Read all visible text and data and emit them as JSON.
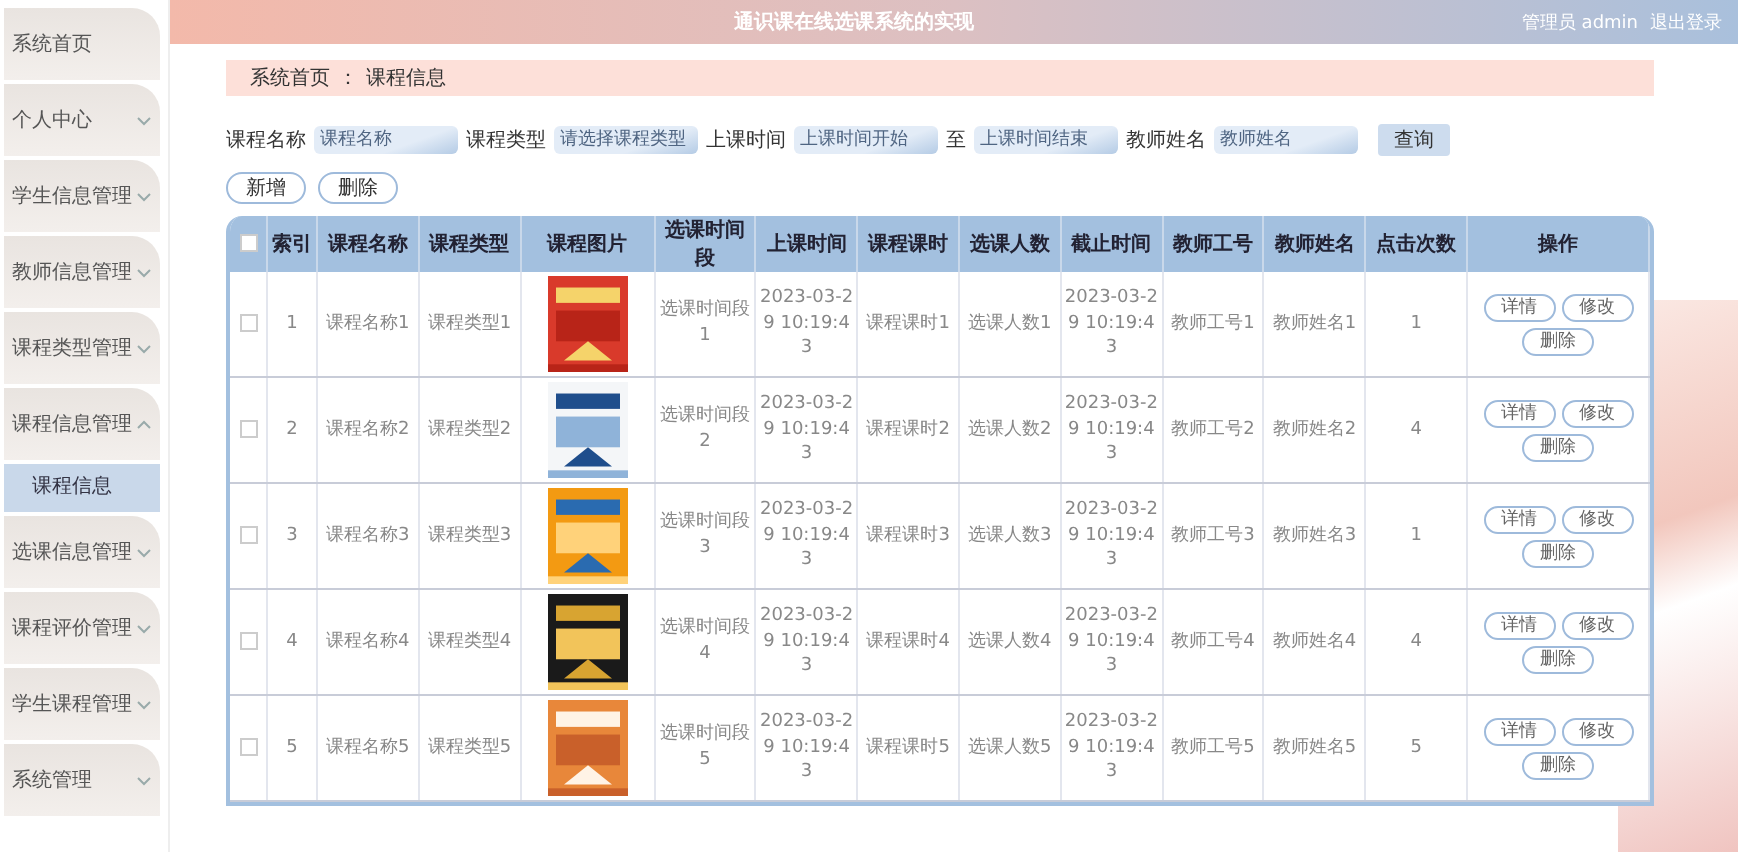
{
  "header": {
    "title": "通识课在线选课系统的实现",
    "user": "管理员 admin",
    "logout": "退出登录"
  },
  "sidebar": {
    "items": [
      {
        "label": "系统首页",
        "kind": "link"
      },
      {
        "label": "个人中心",
        "kind": "menu",
        "expanded": false
      },
      {
        "label": "学生信息管理",
        "kind": "menu",
        "expanded": false
      },
      {
        "label": "教师信息管理",
        "kind": "menu",
        "expanded": false
      },
      {
        "label": "课程类型管理",
        "kind": "menu",
        "expanded": false
      },
      {
        "label": "课程信息管理",
        "kind": "menu",
        "expanded": true,
        "children": [
          {
            "label": "课程信息",
            "selected": true
          }
        ]
      },
      {
        "label": "选课信息管理",
        "kind": "menu",
        "expanded": false
      },
      {
        "label": "课程评价管理",
        "kind": "menu",
        "expanded": false
      },
      {
        "label": "学生课程管理",
        "kind": "menu",
        "expanded": false
      },
      {
        "label": "系统管理",
        "kind": "menu",
        "expanded": false
      }
    ]
  },
  "breadcrumb": {
    "home": "系统首页",
    "separator": "：",
    "current": "课程信息"
  },
  "search": {
    "fields": [
      {
        "label": "课程名称",
        "placeholder": "课程名称"
      },
      {
        "label": "课程类型",
        "placeholder": "请选择课程类型"
      },
      {
        "label": "上课时间",
        "placeholder": "上课时间开始"
      },
      {
        "label": "至",
        "placeholder": "上课时间结束"
      },
      {
        "label": "教师姓名",
        "placeholder": "教师姓名"
      }
    ],
    "button": "查询"
  },
  "actions": [
    "新增",
    "删除"
  ],
  "table": {
    "columns": [
      {
        "kind": "checkbox",
        "checked": false
      },
      {
        "kind": "text",
        "label": "索引"
      },
      {
        "kind": "text",
        "label": "课程名称"
      },
      {
        "kind": "text",
        "label": "课程类型"
      },
      {
        "kind": "text",
        "label": "课程图片"
      },
      {
        "kind": "text",
        "label": "选课时间段"
      },
      {
        "kind": "text",
        "label": "上课时间"
      },
      {
        "kind": "text",
        "label": "课程课时"
      },
      {
        "kind": "text",
        "label": "选课人数"
      },
      {
        "kind": "text",
        "label": "截止时间"
      },
      {
        "kind": "text",
        "label": "教师工号"
      },
      {
        "kind": "text",
        "label": "教师姓名"
      },
      {
        "kind": "text",
        "label": "点击次数"
      },
      {
        "kind": "text",
        "label": "操作"
      }
    ],
    "rows": [
      {
        "cells": [
          {
            "kind": "checkbox",
            "checked": false
          },
          {
            "kind": "text",
            "text": "1"
          },
          {
            "kind": "text",
            "text": "课程名称1"
          },
          {
            "kind": "text",
            "text": "课程类型1"
          },
          {
            "kind": "picture"
          },
          {
            "kind": "text",
            "text": "选课时间段1"
          },
          {
            "kind": "text",
            "text": "2023-03-29 10:19:43"
          },
          {
            "kind": "text",
            "text": "课程课时1"
          },
          {
            "kind": "text",
            "text": "选课人数1"
          },
          {
            "kind": "text",
            "text": "2023-03-29 10:19:43"
          },
          {
            "kind": "text",
            "text": "教师工号1"
          },
          {
            "kind": "text",
            "text": "教师姓名1"
          },
          {
            "kind": "text",
            "text": "1"
          },
          {
            "kind": "buttons",
            "buttons": [
              "详情",
              "修改",
              "删除"
            ]
          }
        ]
      },
      {
        "cells": [
          {
            "kind": "checkbox",
            "checked": false
          },
          {
            "kind": "text",
            "text": "2"
          },
          {
            "kind": "text",
            "text": "课程名称2"
          },
          {
            "kind": "text",
            "text": "课程类型2"
          },
          {
            "kind": "picture"
          },
          {
            "kind": "text",
            "text": "选课时间段2"
          },
          {
            "kind": "text",
            "text": "2023-03-29 10:19:43"
          },
          {
            "kind": "text",
            "text": "课程课时2"
          },
          {
            "kind": "text",
            "text": "选课人数2"
          },
          {
            "kind": "text",
            "text": "2023-03-29 10:19:43"
          },
          {
            "kind": "text",
            "text": "教师工号2"
          },
          {
            "kind": "text",
            "text": "教师姓名2"
          },
          {
            "kind": "text",
            "text": "4"
          },
          {
            "kind": "buttons",
            "buttons": [
              "详情",
              "修改",
              "删除"
            ]
          }
        ]
      },
      {
        "cells": [
          {
            "kind": "checkbox",
            "checked": false
          },
          {
            "kind": "text",
            "text": "3"
          },
          {
            "kind": "text",
            "text": "课程名称3"
          },
          {
            "kind": "text",
            "text": "课程类型3"
          },
          {
            "kind": "picture"
          },
          {
            "kind": "text",
            "text": "选课时间段3"
          },
          {
            "kind": "text",
            "text": "2023-03-29 10:19:43"
          },
          {
            "kind": "text",
            "text": "课程课时3"
          },
          {
            "kind": "text",
            "text": "选课人数3"
          },
          {
            "kind": "text",
            "text": "2023-03-29 10:19:43"
          },
          {
            "kind": "text",
            "text": "教师工号3"
          },
          {
            "kind": "text",
            "text": "教师姓名3"
          },
          {
            "kind": "text",
            "text": "1"
          },
          {
            "kind": "buttons",
            "buttons": [
              "详情",
              "修改",
              "删除"
            ]
          }
        ]
      },
      {
        "cells": [
          {
            "kind": "checkbox",
            "checked": false
          },
          {
            "kind": "text",
            "text": "4"
          },
          {
            "kind": "text",
            "text": "课程名称4"
          },
          {
            "kind": "text",
            "text": "课程类型4"
          },
          {
            "kind": "picture"
          },
          {
            "kind": "text",
            "text": "选课时间段4"
          },
          {
            "kind": "text",
            "text": "2023-03-29 10:19:43"
          },
          {
            "kind": "text",
            "text": "课程课时4"
          },
          {
            "kind": "text",
            "text": "选课人数4"
          },
          {
            "kind": "text",
            "text": "2023-03-29 10:19:43"
          },
          {
            "kind": "text",
            "text": "教师工号4"
          },
          {
            "kind": "text",
            "text": "教师姓名4"
          },
          {
            "kind": "text",
            "text": "4"
          },
          {
            "kind": "buttons",
            "buttons": [
              "详情",
              "修改",
              "删除"
            ]
          }
        ]
      },
      {
        "cells": [
          {
            "kind": "checkbox",
            "checked": false
          },
          {
            "kind": "text",
            "text": "5"
          },
          {
            "kind": "text",
            "text": "课程名称5"
          },
          {
            "kind": "text",
            "text": "课程类型5"
          },
          {
            "kind": "picture"
          },
          {
            "kind": "text",
            "text": "选课时间段5"
          },
          {
            "kind": "text",
            "text": "2023-03-29 10:19:43"
          },
          {
            "kind": "text",
            "text": "课程课时5"
          },
          {
            "kind": "text",
            "text": "选课人数5"
          },
          {
            "kind": "text",
            "text": "2023-03-29 10:19:43"
          },
          {
            "kind": "text",
            "text": "教师工号5"
          },
          {
            "kind": "text",
            "text": "教师姓名5"
          },
          {
            "kind": "text",
            "text": "5"
          },
          {
            "kind": "buttons",
            "buttons": [
              "详情",
              "修改",
              "删除"
            ]
          }
        ]
      }
    ]
  }
}
